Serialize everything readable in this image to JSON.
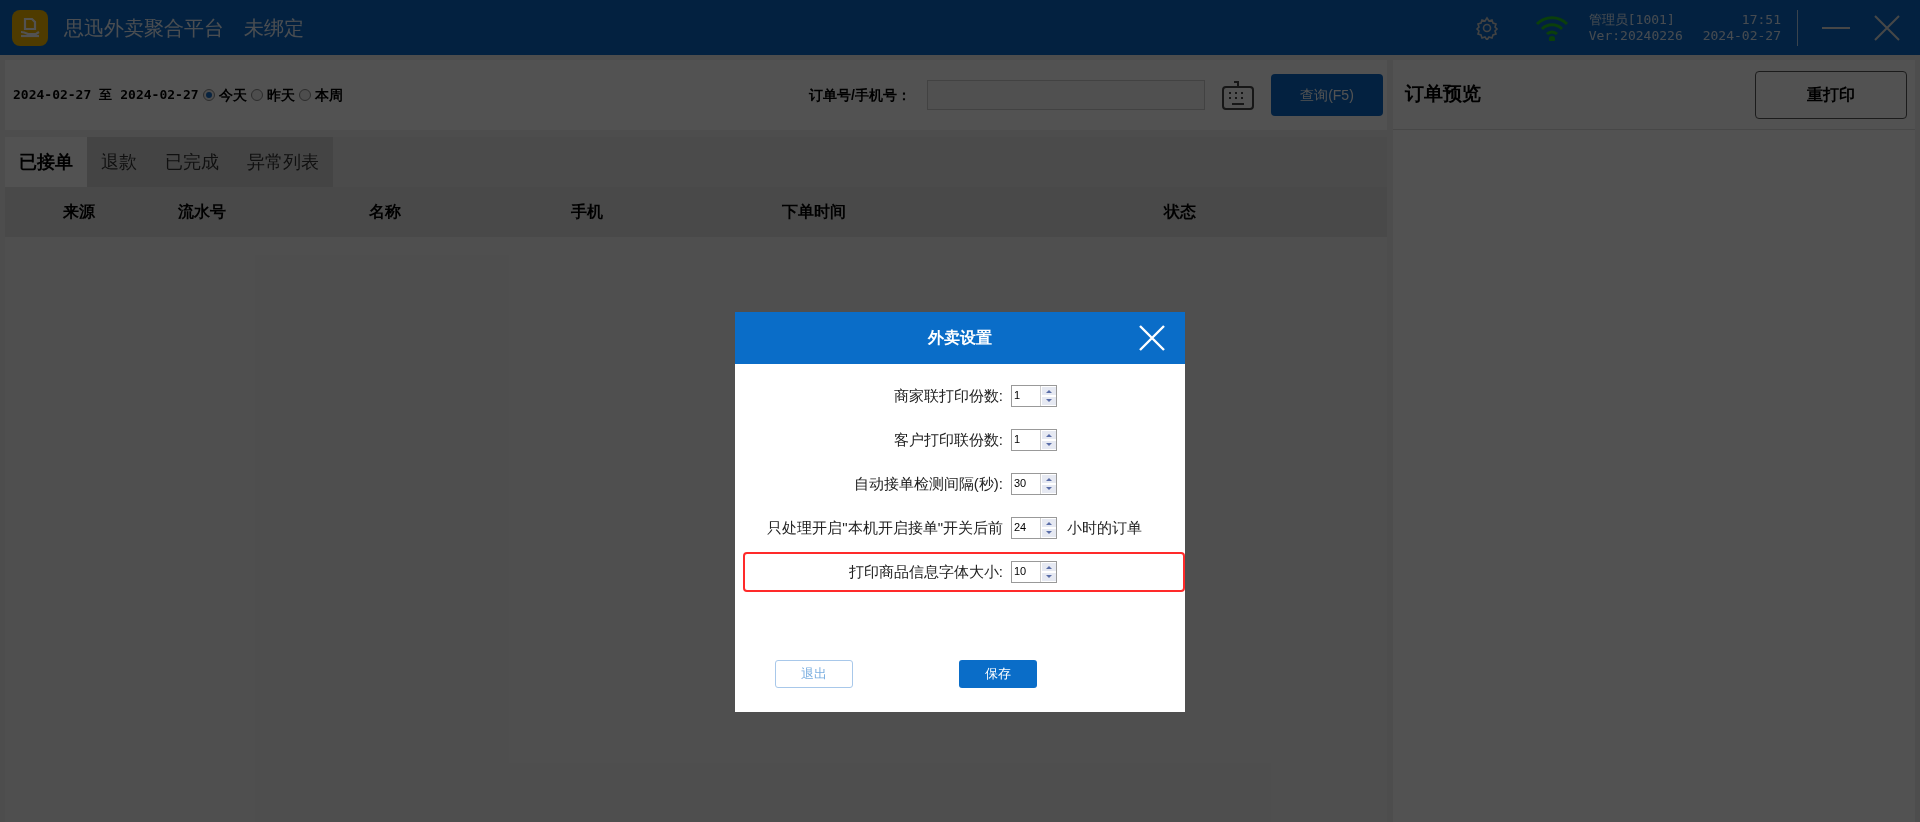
{
  "app_bar": {
    "title": "思迅外卖聚合平台",
    "binding": "未绑定",
    "user": "管理员[1001]",
    "version": "Ver:20240226",
    "time": "17:51",
    "date": "2024-02-27"
  },
  "filter": {
    "date_from": "2024-02-27",
    "to": "至",
    "date_to": "2024-02-27",
    "ranges": [
      {
        "label": "今天",
        "selected": true
      },
      {
        "label": "昨天",
        "selected": false
      },
      {
        "label": "本周",
        "selected": false
      }
    ],
    "search_label": "订单号/手机号：",
    "search_button": "查询(F5)"
  },
  "tabs": [
    {
      "label": "已接单",
      "selected": true
    },
    {
      "label": "退款",
      "selected": false
    },
    {
      "label": "已完成",
      "selected": false
    },
    {
      "label": "异常列表",
      "selected": false
    }
  ],
  "table": {
    "columns": [
      "来源",
      "流水号",
      "名称",
      "手机",
      "下单时间",
      "状态"
    ]
  },
  "preview": {
    "title": "订单预览",
    "reprint_button": "重打印"
  },
  "dialog": {
    "title": "外卖设置",
    "rows": [
      {
        "label": "商家联打印份数:",
        "value": "1",
        "highlighted": false
      },
      {
        "label": "客户打印联份数:",
        "value": "1",
        "highlighted": false
      },
      {
        "label": "自动接单检测间隔(秒):",
        "value": "30",
        "highlighted": false
      },
      {
        "label": "只处理开启\"本机开启接单\"开关后前",
        "value": "24",
        "suffix": "小时的订单",
        "highlighted": false
      },
      {
        "label": "打印商品信息字体大小:",
        "value": "10",
        "highlighted": true
      }
    ],
    "buttons": [
      {
        "label": "退出",
        "kind": "secondary"
      },
      {
        "label": "保存",
        "kind": "primary"
      }
    ]
  }
}
